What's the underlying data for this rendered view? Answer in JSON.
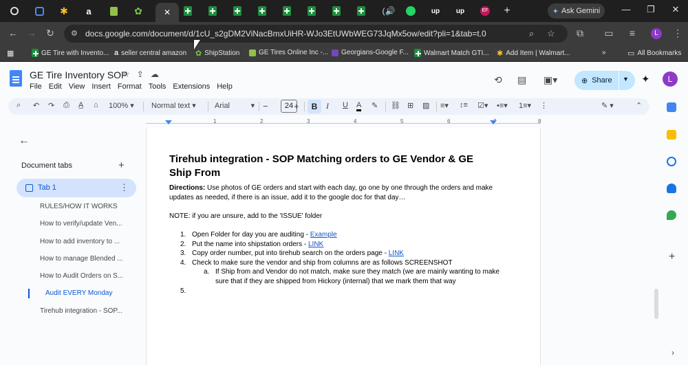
{
  "browser": {
    "tabs": [
      {
        "icon": "chatgpt-icon"
      },
      {
        "icon": "generic-blue-icon"
      },
      {
        "icon": "walmart-spark-icon"
      },
      {
        "icon": "amazon-icon"
      },
      {
        "icon": "shopify-icon"
      },
      {
        "icon": "shipstation-gear-icon"
      },
      {
        "icon": "close-icon",
        "active": true
      },
      {
        "icon": "sheets-icon"
      },
      {
        "icon": "sheets-icon"
      },
      {
        "icon": "sheets-icon"
      },
      {
        "icon": "sheets-icon"
      },
      {
        "icon": "sheets-icon"
      },
      {
        "icon": "sheets-icon"
      },
      {
        "icon": "sheets-icon"
      },
      {
        "icon": "sheets-icon"
      },
      {
        "icon": "audio-icon"
      },
      {
        "icon": "whatsapp-icon"
      },
      {
        "icon": "upwork-icon"
      },
      {
        "icon": "upwork-icon"
      },
      {
        "icon": "ef-icon"
      }
    ],
    "new_tab_label": "+",
    "ask_gemini_label": "Ask Gemini",
    "url": "docs.google.com/document/d/1cU_s2gDM2ViNacBmxUiHR-WJo3EtUWbWEG73JqMx5ow/edit?pli=1&tab=t.0",
    "profile_initial": "L",
    "bookmarks": [
      {
        "label": "GE Tire with Invento...",
        "icon": "sheets-icon"
      },
      {
        "label": "seller central amazon",
        "icon": "amazon-icon"
      },
      {
        "label": "ShipStation",
        "icon": "shipstation-gear-icon"
      },
      {
        "label": "GE Tires Online Inc -...",
        "icon": "shopify-icon"
      },
      {
        "label": "Georgians-Google F...",
        "icon": "forms-icon"
      },
      {
        "label": "Walmart Match GTI...",
        "icon": "sheets-icon"
      },
      {
        "label": "Add Item | Walmart...",
        "icon": "walmart-spark-icon"
      }
    ],
    "bookmarks_more": "»",
    "all_bookmarks_label": "All Bookmarks"
  },
  "doc": {
    "title": "GE Tire Inventory SOP",
    "menu": [
      "File",
      "Edit",
      "View",
      "Insert",
      "Format",
      "Tools",
      "Extensions",
      "Help"
    ],
    "share_label": "Share",
    "account_initial": "L"
  },
  "toolbar": {
    "zoom": "100%",
    "style": "Normal text",
    "font": "Arial",
    "font_size": "24",
    "minus": "−",
    "plus": "+"
  },
  "ruler": {
    "numbers": [
      "1",
      "2",
      "3",
      "4",
      "5",
      "6",
      "7",
      "8"
    ]
  },
  "outline": {
    "header": "Document tabs",
    "tab_name": "Tab 1",
    "items": [
      "RULES/HOW IT WORKS",
      "How to verify/update Ven...",
      "How to add inventory to ...",
      "How to manage Blended ...",
      "How to Audit Orders on S...",
      "Audit EVERY Monday",
      "Tirehub integration - SOP..."
    ],
    "active_index": 5
  },
  "content": {
    "heading": "Tirehub integration - SOP Matching orders to GE Vendor & GE Ship From",
    "directions_label": "Directions:",
    "directions_text": " Use photos of GE orders and start with each day, go one by one through the orders and make updates as needed, if there is an issue, add it to the google doc for that day…",
    "note": "NOTE: if you are unsure, add to the 'ISSUE' folder",
    "steps": [
      {
        "num": "1.",
        "text": "Open Folder for day you are auditing - ",
        "link": "Example"
      },
      {
        "num": "2.",
        "text": "Put the name into shipstation orders - ",
        "link": "LINK"
      },
      {
        "num": "3.",
        "text": "Copy order number, put into tirehub search on the orders page - ",
        "link": "LINK"
      },
      {
        "num": "4.",
        "text": "Check to make sure the vendor and ship from columns are as follows SCREENSHOT",
        "link": ""
      }
    ],
    "substep": {
      "num": "a.",
      "text": "If Ship from and Vendor do not match, make sure they match (we are mainly wanting to make sure that if they are shipped from Hickory (internal) that we mark them that way"
    },
    "step5": "5."
  }
}
